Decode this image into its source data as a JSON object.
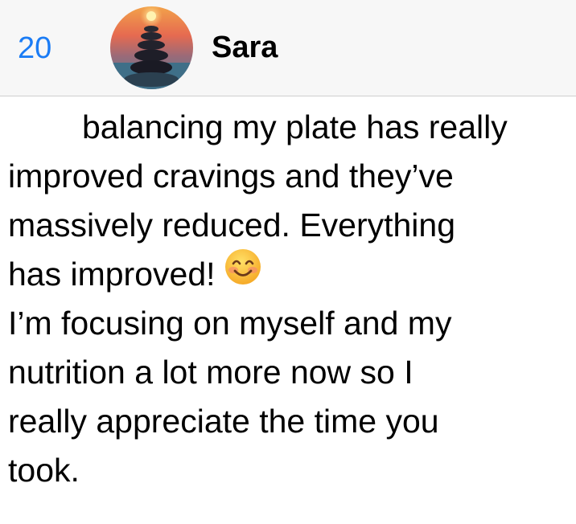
{
  "header": {
    "back_count": "20",
    "contact_name": "Sara",
    "avatar_icon": "stacked-stones-avatar"
  },
  "message": {
    "lines": [
      "balancing my plate has really",
      "improved cravings and they’ve",
      "massively reduced. Everything",
      "has improved!",
      "I’m focusing on myself and my",
      "nutrition a lot more now so I",
      "really appreciate the time you",
      "took."
    ],
    "emoji": "smiling-face-icon"
  },
  "colors": {
    "accent": "#1b7cf5",
    "header_bg": "#f7f7f7",
    "text": "#000000"
  }
}
